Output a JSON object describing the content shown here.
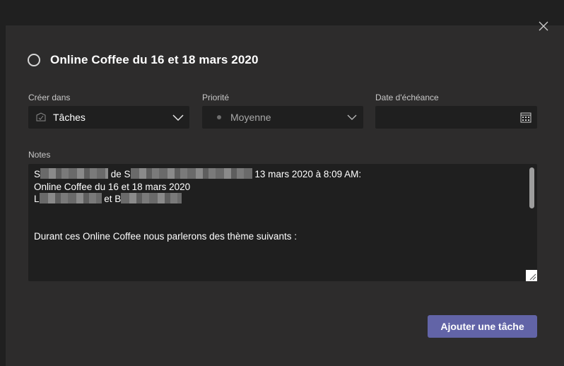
{
  "dialog": {
    "title": "Online Coffee du 16 et 18 mars 2020",
    "close_icon": "close-icon"
  },
  "fields": {
    "create_in": {
      "label": "Créer dans",
      "value": "Tâches",
      "icon": "bucket-icon"
    },
    "priority": {
      "label": "Priorité",
      "value": "Moyenne",
      "icon": "dot-icon"
    },
    "due_date": {
      "label": "Date d'échéance",
      "value": "",
      "icon": "calendar-icon"
    }
  },
  "notes": {
    "label": "Notes",
    "line1_a": "S",
    "line1_b": "de S",
    "line1_c": "13 mars 2020 à 8:09 AM:",
    "line2": "Online Coffee du 16 et 18 mars 2020",
    "line3_a": "L",
    "line3_b": "et B",
    "line6": "Durant ces Online Coffee nous parlerons des thème suivants :"
  },
  "actions": {
    "submit_label": "Ajouter une tâche"
  },
  "colors": {
    "accent": "#6264a7",
    "background": "#2d2c2c",
    "field_background": "#1f1f1f"
  }
}
